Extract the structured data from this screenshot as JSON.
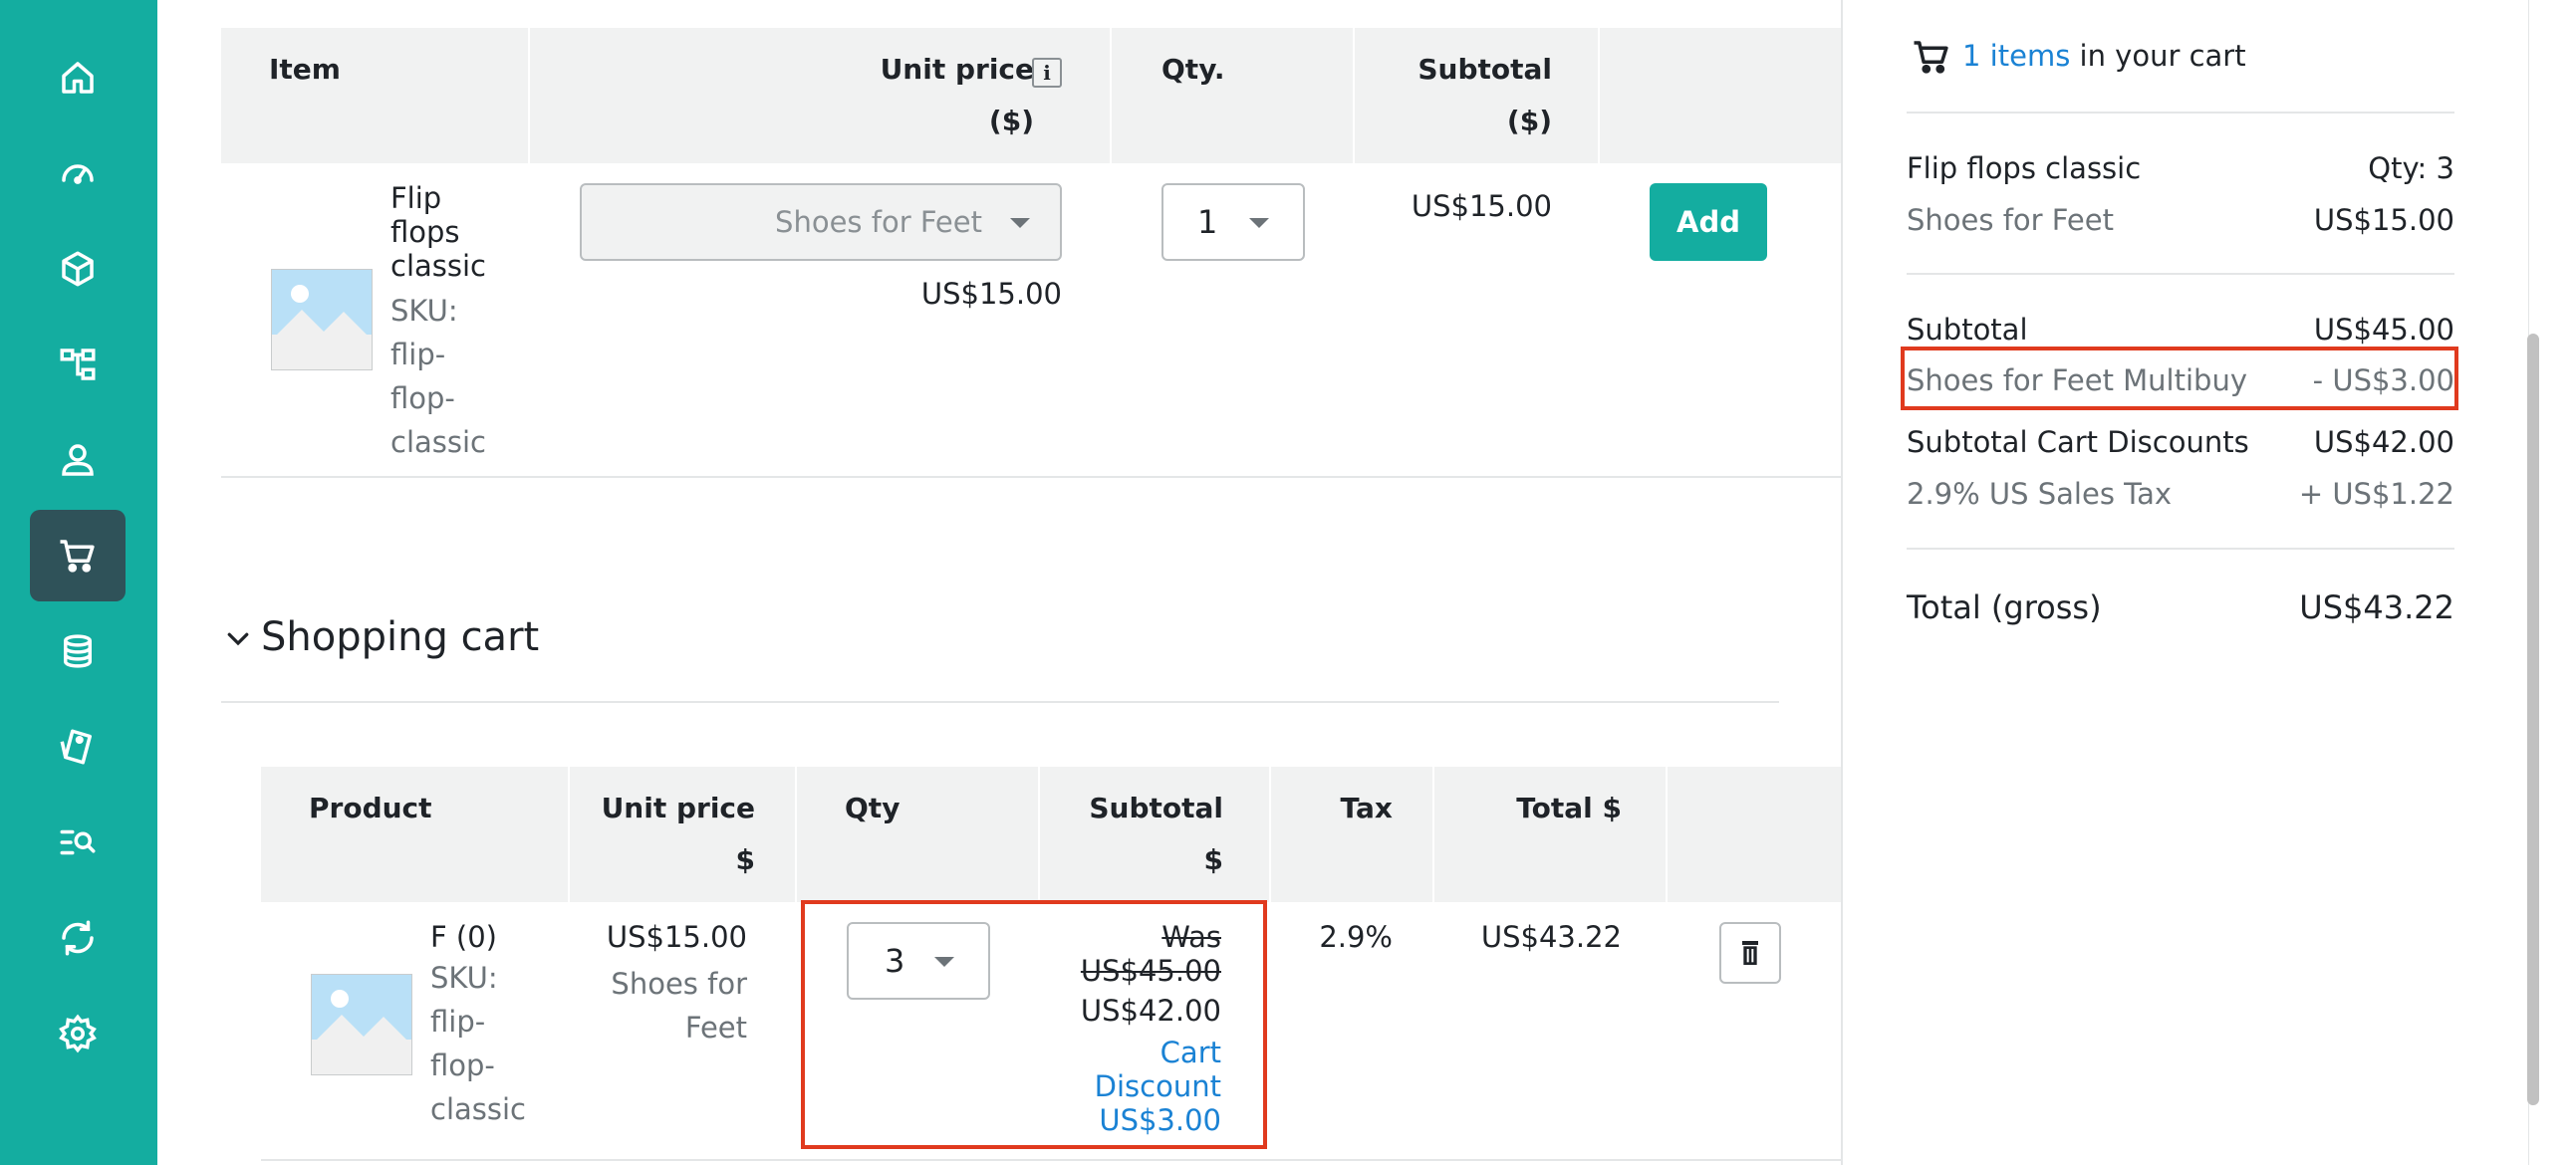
{
  "colors": {
    "accent": "#14ada0",
    "accent_dark": "#2f5259",
    "link": "#1a82d4",
    "highlight": "#e03a1e"
  },
  "sidebar": {
    "items": [
      {
        "icon": "home-icon"
      },
      {
        "icon": "dashboard-icon"
      },
      {
        "icon": "box-icon"
      },
      {
        "icon": "hierarchy-icon"
      },
      {
        "icon": "user-icon"
      },
      {
        "icon": "cart-icon",
        "active": true
      },
      {
        "icon": "coins-icon"
      },
      {
        "icon": "tag-icon"
      },
      {
        "icon": "search-list-icon"
      },
      {
        "icon": "sync-icon"
      },
      {
        "icon": "gear-icon"
      }
    ]
  },
  "product_table": {
    "headers": {
      "item": "Item",
      "unit_price": "Unit price ($)",
      "qty": "Qty.",
      "subtotal_line1": "Subtotal",
      "subtotal_line2": "($)"
    },
    "info_icon": "i",
    "row": {
      "name_lines": [
        "Flip",
        "flops",
        "classic"
      ],
      "sku_lines": [
        "SKU:",
        "flip-",
        "flop-",
        "classic"
      ],
      "price_select": "Shoes for Feet",
      "price": "US$15.00",
      "qty": "1",
      "subtotal": "US$15.00",
      "add_label": "Add"
    }
  },
  "cart_section": {
    "title": "Shopping cart"
  },
  "cart_table": {
    "headers": {
      "product": "Product",
      "unit_price_line1": "Unit price",
      "unit_price_line2": "$",
      "qty": "Qty",
      "subtotal_line1": "Subtotal",
      "subtotal_line2": "$",
      "tax": "Tax",
      "total": "Total $"
    },
    "row": {
      "name": "F (0)",
      "sku_lines": [
        "SKU:",
        "flip-",
        "flop-",
        "classic"
      ],
      "unit_price": "US$15.00",
      "price_list_lines": [
        "Shoes for",
        "Feet"
      ],
      "qty": "3",
      "was_label": "Was",
      "was_price": "US$45.00",
      "subtotal": "US$42.00",
      "discount_lines": [
        "Cart",
        "Discount",
        "US$3.00"
      ],
      "tax": "2.9%",
      "total": "US$43.22"
    }
  },
  "cart_summary": {
    "count_link": "1 items",
    "count_suffix": " in your cart",
    "item_name": "Flip flops classic",
    "item_qty": "Qty: 3",
    "item_price_list": "Shoes for Feet",
    "item_price": "US$15.00",
    "subtotal_label": "Subtotal",
    "subtotal_value": "US$45.00",
    "multibuy_label": "Shoes for Feet Multibuy",
    "multibuy_value": "- US$3.00",
    "subtotal_discounts_label": "Subtotal Cart Discounts",
    "subtotal_discounts_value": "US$42.00",
    "tax_label": "2.9% US Sales Tax",
    "tax_value": "+ US$1.22",
    "total_label": "Total (gross)",
    "total_value": "US$43.22"
  }
}
